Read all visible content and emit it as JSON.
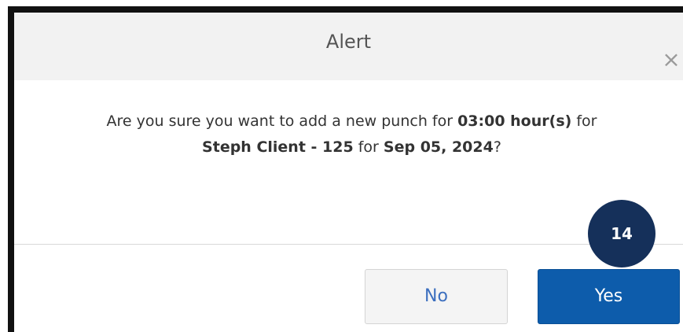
{
  "dialog": {
    "title": "Alert",
    "close_icon": "close-icon",
    "close_glyph": "×",
    "message": {
      "prefix": "Are you sure you want to add a new punch for ",
      "hours": "03:00 hour(s)",
      "mid1": " for ",
      "client": "Steph Client - 125",
      "mid2": " for ",
      "date": "Sep 05, 2024",
      "suffix": "?"
    },
    "buttons": {
      "no_label": "No",
      "yes_label": "Yes"
    }
  },
  "annotation": {
    "step_number": "14"
  },
  "colors": {
    "header_bg": "#f2f2f2",
    "yes_button": "#0d5cab",
    "no_button_text": "#3c6fbf",
    "step_badge": "#15305a"
  }
}
